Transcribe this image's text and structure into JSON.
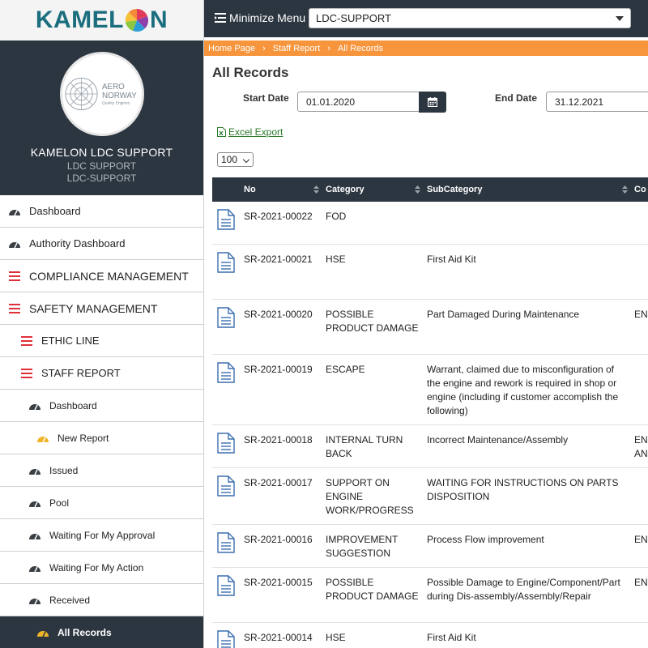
{
  "logo": {
    "text_left": "KAMEL",
    "text_right": "N"
  },
  "profile": {
    "org_logo_text_1": "AERO",
    "org_logo_text_2": "NORWAY",
    "org_logo_text_3": "Quality Engines",
    "name": "KAMELON LDC SUPPORT",
    "sub1": "LDC SUPPORT",
    "sub2": "LDC-SUPPORT"
  },
  "sidebar": {
    "items": [
      {
        "label": "Dashboard"
      },
      {
        "label": "Authority Dashboard"
      },
      {
        "label": "COMPLIANCE MANAGEMENT"
      },
      {
        "label": "SAFETY MANAGEMENT"
      },
      {
        "label": "ETHIC LINE"
      },
      {
        "label": "STAFF REPORT"
      },
      {
        "label": "Dashboard"
      },
      {
        "label": "New Report"
      },
      {
        "label": "Issued"
      },
      {
        "label": "Pool"
      },
      {
        "label": "Waiting For My Approval"
      },
      {
        "label": "Waiting For My Action"
      },
      {
        "label": "Received"
      },
      {
        "label": "All Records"
      }
    ]
  },
  "topbar": {
    "minimize_label": "Minimize Menu",
    "select_value": "LDC-SUPPORT"
  },
  "breadcrumb": [
    "Home Page",
    "Staff Report",
    "All Records"
  ],
  "page": {
    "title": "All Records"
  },
  "filters": {
    "start_label": "Start Date",
    "start_value": "01.01.2020",
    "end_label": "End Date",
    "end_value": "31.12.2021"
  },
  "excel_export_label": "Excel Export",
  "page_size": "100",
  "table": {
    "columns": [
      "No",
      "Category",
      "SubCategory",
      "Co"
    ],
    "rows": [
      {
        "no": "SR-2021-00022",
        "category": "FOD",
        "subcategory": "",
        "extra": ""
      },
      {
        "no": "SR-2021-00021",
        "category": "HSE",
        "subcategory": "First Aid Kit",
        "extra": ""
      },
      {
        "no": "SR-2021-00020",
        "category": "POSSIBLE PRODUCT DAMAGE",
        "subcategory": "Part Damaged During Maintenance",
        "extra": "EN W"
      },
      {
        "no": "SR-2021-00019",
        "category": "ESCAPE",
        "subcategory": "Warrant, claimed due to misconfiguration of the engine and rework is required in shop or engine (including if customer accomplish the following)",
        "extra": ""
      },
      {
        "no": "SR-2021-00018",
        "category": "INTERNAL TURN BACK",
        "subcategory": "Incorrect Maintenance/Assembly",
        "extra": "EN AN"
      },
      {
        "no": "SR-2021-00017",
        "category": "SUPPORT ON ENGINE WORK/PROGRESS",
        "subcategory": "WAITING FOR INSTRUCTIONS ON PARTS DISPOSITION",
        "extra": ""
      },
      {
        "no": "SR-2021-00016",
        "category": "IMPROVEMENT SUGGESTION",
        "subcategory": "Process Flow improvement",
        "extra": "EN W"
      },
      {
        "no": "SR-2021-00015",
        "category": "POSSIBLE PRODUCT DAMAGE",
        "subcategory": "Possible Damage to Engine/Component/Part during Dis-assembly/Assembly/Repair",
        "extra": "EN W"
      },
      {
        "no": "SR-2021-00014",
        "category": "HSE",
        "subcategory": "First Aid Kit",
        "extra": ""
      }
    ]
  },
  "colors": {
    "dark": "#2c3640",
    "accent_orange": "#f7953d",
    "menu_red": "#e0303a",
    "gold": "#f0b429"
  }
}
